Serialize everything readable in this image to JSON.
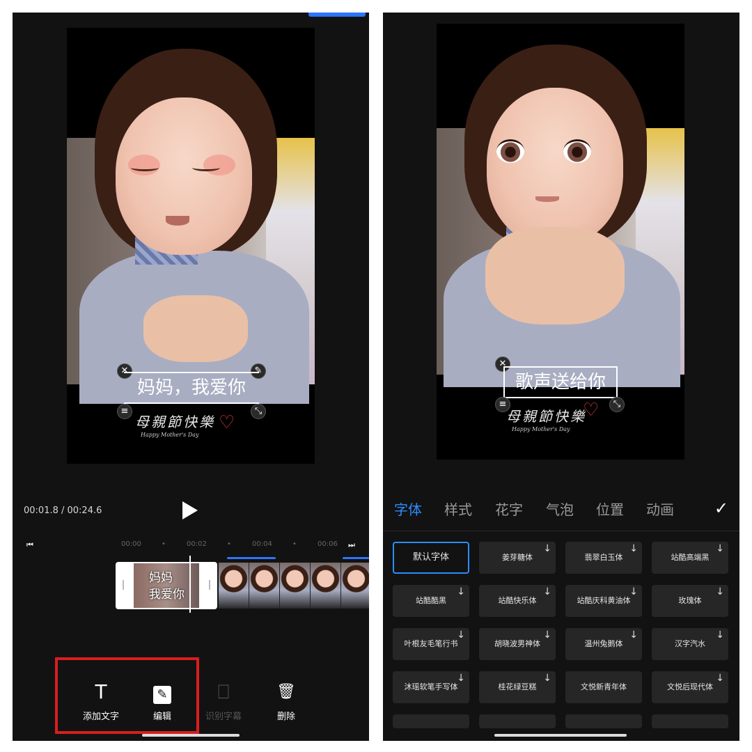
{
  "left": {
    "caption_text": "妈妈，我爱你",
    "sticker": {
      "main": "母親節快樂",
      "sub": "Happy Mother's Day"
    },
    "time_display": "00:01.8 / 00:24.6",
    "ruler_labels": [
      "00:00",
      "00:02",
      "00:04",
      "00:06"
    ],
    "clip_text": [
      "妈妈",
      "我爱你"
    ],
    "toolbar": [
      {
        "name": "add-text-button",
        "icon": "text-T-icon",
        "glyph": "T",
        "label": "添加文字",
        "enabled": true
      },
      {
        "name": "edit-button",
        "icon": "pencil-icon",
        "glyph": "✎",
        "label": "编辑",
        "enabled": true
      },
      {
        "name": "recognize-subtitles-button",
        "icon": "subtitle-scan-icon",
        "glyph": "⎕",
        "label": "识别字幕",
        "enabled": false
      },
      {
        "name": "delete-button",
        "icon": "trash-icon",
        "glyph": "🗑",
        "label": "删除",
        "enabled": true
      }
    ],
    "highlight_color": "#d81e1e"
  },
  "right": {
    "caption_text": "歌声送给你",
    "sticker": {
      "main": "母親節快樂",
      "sub": "Happy Mother's Day"
    },
    "tabs": [
      "字体",
      "样式",
      "花字",
      "气泡",
      "位置",
      "动画"
    ],
    "active_tab": "字体",
    "confirm_icon": "checkmark-icon",
    "fonts": [
      "默认字体",
      "姜芽糖体",
      "翡翠白玉体",
      "站酷高端黑",
      "站酷酷黑",
      "站酷快乐体",
      "站酷庆科黄油体",
      "玫瑰体",
      "叶根友毛笔行书",
      "胡晓波男神体",
      "温州兔鹅体",
      "汉字汽水",
      "沐瑶软笔手写体",
      "桂花绿豆糕",
      "文悦新青年体",
      "文悦后现代体"
    ],
    "selected_font": "默认字体"
  },
  "colors": {
    "accent": "#2d8cff",
    "background": "#121212"
  }
}
